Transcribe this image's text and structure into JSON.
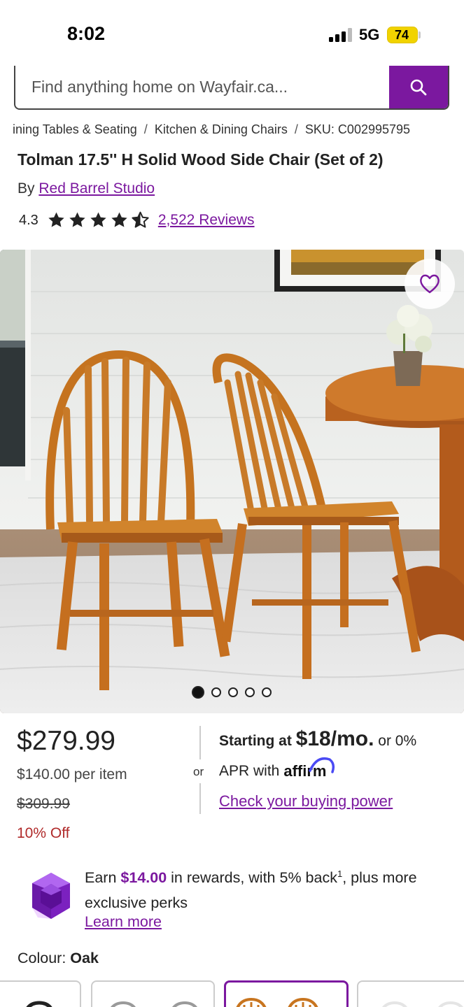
{
  "status_bar": {
    "time": "8:02",
    "network": "5G",
    "battery": "74"
  },
  "search": {
    "placeholder": "Find anything home on Wayfair.ca..."
  },
  "breadcrumb": {
    "items": [
      "ining Tables & Seating",
      "Kitchen & Dining Chairs",
      "SKU: C002995795"
    ],
    "separator": "/"
  },
  "product": {
    "title": "Tolman 17.5'' H Solid Wood Side Chair (Set of 2)",
    "by_label": "By",
    "brand": "Red Barrel Studio",
    "rating": "4.3",
    "rating_value": 4.3,
    "rating_max": 5,
    "reviews": "2,522 Reviews"
  },
  "gallery": {
    "image_count": 5,
    "active_index": 0
  },
  "pricing": {
    "price": "$279.99",
    "per_item": "$140.00 per item",
    "was_price": "$309.99",
    "discount": "10% Off",
    "or_label": "or",
    "financing_prefix": "Starting at",
    "financing_amount": "$18/mo.",
    "financing_suffix": "or 0%",
    "financing_line2": "APR with",
    "affirm_brand": "affirm",
    "buying_power": "Check your buying power"
  },
  "rewards": {
    "pre": "Earn",
    "amount": "$14.00",
    "mid": "in rewards, with 5% back",
    "footnote": "1",
    "post": ", plus more exclusive perks",
    "learn_more": "Learn more"
  },
  "colour": {
    "label": "Colour:",
    "value": "Oak"
  },
  "colors": {
    "brand_purple": "#7b189f",
    "discount_red": "#b02a2a",
    "star": "#222222",
    "oak": "#c8751f"
  },
  "icons": {
    "search": "search-icon",
    "favorite": "heart-icon",
    "rewards": "gem-icon"
  }
}
